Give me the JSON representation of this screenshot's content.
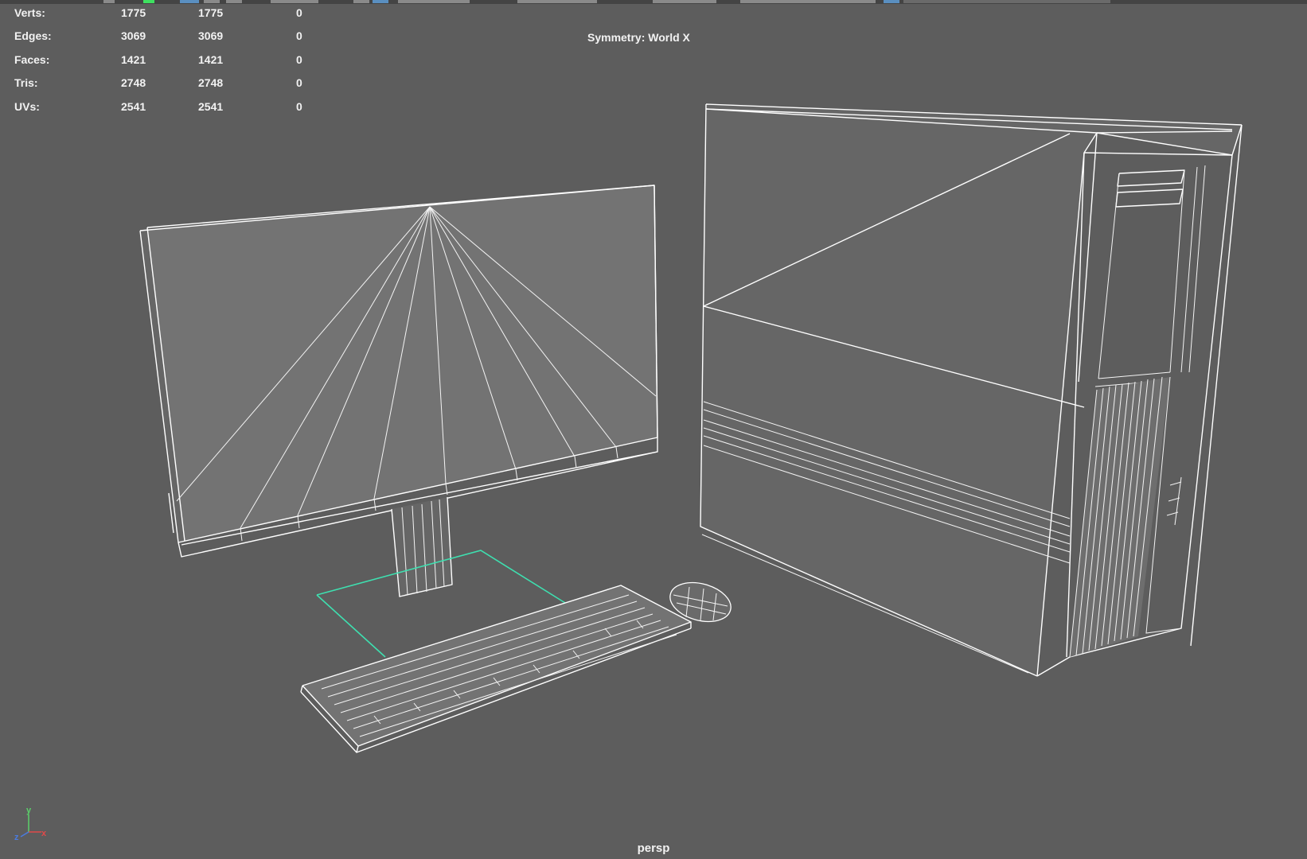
{
  "heads_up_display": {
    "poly_count": [
      {
        "label": "Verts:",
        "values": [
          "1775",
          "1775",
          "0"
        ]
      },
      {
        "label": "Edges:",
        "values": [
          "3069",
          "3069",
          "0"
        ]
      },
      {
        "label": "Faces:",
        "values": [
          "1421",
          "1421",
          "0"
        ]
      },
      {
        "label": "Tris:",
        "values": [
          "2748",
          "2748",
          "0"
        ]
      },
      {
        "label": "UVs:",
        "values": [
          "2541",
          "2541",
          "0"
        ]
      }
    ],
    "symmetry": "Symmetry: World X"
  },
  "viewport": {
    "camera": "persp",
    "background_color": "#5d5d5d",
    "wireframe_color": "#ffffff",
    "selection_color": "#3ee0b0",
    "axis_gizmo": {
      "x": "x",
      "y": "y",
      "z": "z"
    }
  },
  "scene_objects": [
    "monitor",
    "keyboard",
    "mouse",
    "pc-tower"
  ]
}
